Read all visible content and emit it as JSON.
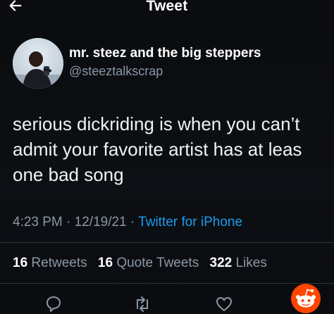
{
  "header": {
    "title": "Tweet",
    "back_icon": "arrow-left-icon"
  },
  "author": {
    "display_name": "mr. steez and the big steppers",
    "handle": "@steeztalkscrap",
    "avatar": "profile-photo"
  },
  "tweet": {
    "lines": [
      "serious dickriding is when you can’t",
      "admit your favorite artist has at leas",
      "one bad song"
    ]
  },
  "meta": {
    "time": "4:23 PM",
    "separator": "·",
    "date": "12/19/21",
    "source": "Twitter for iPhone"
  },
  "stats": {
    "retweets_count": "16",
    "retweets_label": "Retweets",
    "quotes_count": "16",
    "quotes_label": "Quote Tweets",
    "likes_count": "322",
    "likes_label": "Likes"
  },
  "actions": {
    "reply_icon": "comment-icon",
    "retweet_icon": "retweet-icon",
    "like_icon": "heart-icon",
    "watermark_icon": "reddit-logo-icon"
  },
  "colors": {
    "background": "#0b0d10",
    "text": "#f2f3f4",
    "secondary": "#8b98a5",
    "link": "#1d9bf0",
    "divider": "#2f3336",
    "watermark": "#ff4500"
  }
}
